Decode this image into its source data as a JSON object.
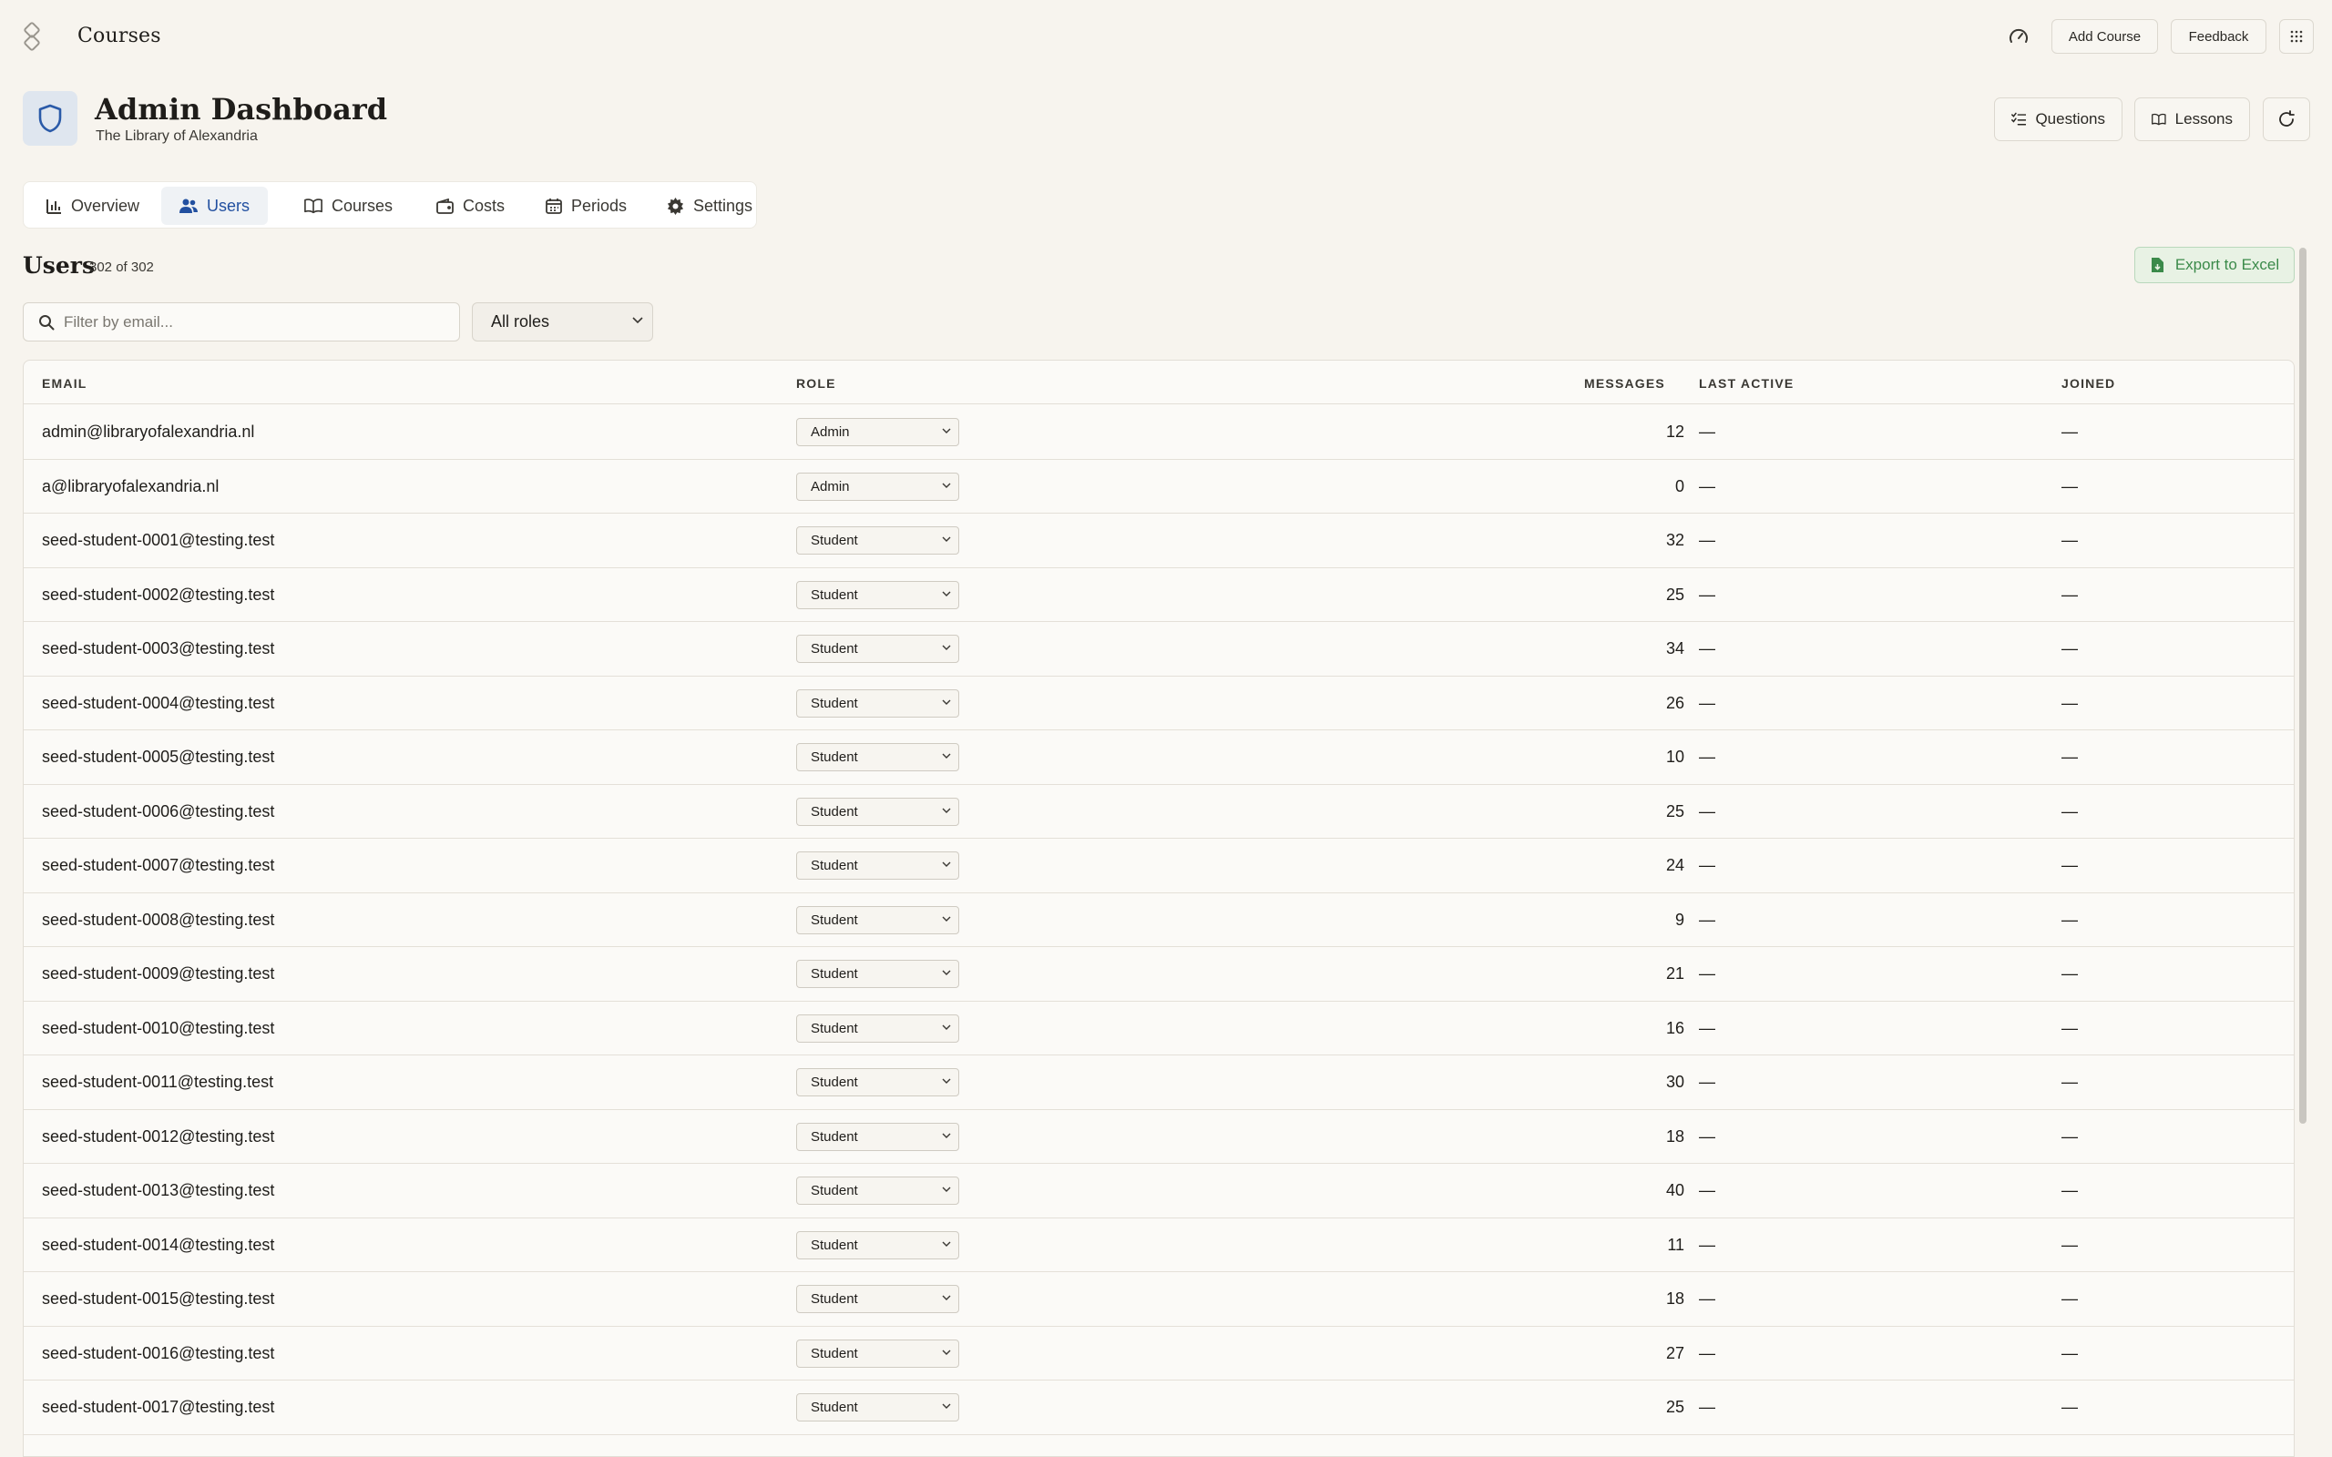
{
  "app": {
    "title": "Courses",
    "buttons": {
      "add_course": "Add Course",
      "feedback": "Feedback"
    }
  },
  "header": {
    "title": "Admin Dashboard",
    "subtitle": "The Library of Alexandria",
    "buttons": {
      "questions": "Questions",
      "lessons": "Lessons"
    }
  },
  "tabs": [
    {
      "label": "Overview",
      "icon": "bar-chart-icon",
      "active": false
    },
    {
      "label": "Users",
      "icon": "users-icon",
      "active": true
    },
    {
      "label": "Courses",
      "icon": "book-icon",
      "active": false
    },
    {
      "label": "Costs",
      "icon": "wallet-icon",
      "active": false
    },
    {
      "label": "Periods",
      "icon": "calendar-icon",
      "active": false
    },
    {
      "label": "Settings",
      "icon": "gear-icon",
      "active": false
    }
  ],
  "users": {
    "title": "Users",
    "count": "302 of 302",
    "export_label": "Export to Excel",
    "search_placeholder": "Filter by email...",
    "role_filter": "All roles"
  },
  "table": {
    "columns": {
      "email": "EMAIL",
      "role": "ROLE",
      "messages": "MESSAGES",
      "last_active": "LAST ACTIVE",
      "joined": "JOINED"
    },
    "rows": [
      {
        "email": "admin@libraryofalexandria.nl",
        "role": "Admin",
        "messages": "12",
        "last_active": "—",
        "joined": "—"
      },
      {
        "email": "a@libraryofalexandria.nl",
        "role": "Admin",
        "messages": "0",
        "last_active": "—",
        "joined": "—"
      },
      {
        "email": "seed-student-0001@testing.test",
        "role": "Student",
        "messages": "32",
        "last_active": "—",
        "joined": "—"
      },
      {
        "email": "seed-student-0002@testing.test",
        "role": "Student",
        "messages": "25",
        "last_active": "—",
        "joined": "—"
      },
      {
        "email": "seed-student-0003@testing.test",
        "role": "Student",
        "messages": "34",
        "last_active": "—",
        "joined": "—"
      },
      {
        "email": "seed-student-0004@testing.test",
        "role": "Student",
        "messages": "26",
        "last_active": "—",
        "joined": "—"
      },
      {
        "email": "seed-student-0005@testing.test",
        "role": "Student",
        "messages": "10",
        "last_active": "—",
        "joined": "—"
      },
      {
        "email": "seed-student-0006@testing.test",
        "role": "Student",
        "messages": "25",
        "last_active": "—",
        "joined": "—"
      },
      {
        "email": "seed-student-0007@testing.test",
        "role": "Student",
        "messages": "24",
        "last_active": "—",
        "joined": "—"
      },
      {
        "email": "seed-student-0008@testing.test",
        "role": "Student",
        "messages": "9",
        "last_active": "—",
        "joined": "—"
      },
      {
        "email": "seed-student-0009@testing.test",
        "role": "Student",
        "messages": "21",
        "last_active": "—",
        "joined": "—"
      },
      {
        "email": "seed-student-0010@testing.test",
        "role": "Student",
        "messages": "16",
        "last_active": "—",
        "joined": "—"
      },
      {
        "email": "seed-student-0011@testing.test",
        "role": "Student",
        "messages": "30",
        "last_active": "—",
        "joined": "—"
      },
      {
        "email": "seed-student-0012@testing.test",
        "role": "Student",
        "messages": "18",
        "last_active": "—",
        "joined": "—"
      },
      {
        "email": "seed-student-0013@testing.test",
        "role": "Student",
        "messages": "40",
        "last_active": "—",
        "joined": "—"
      },
      {
        "email": "seed-student-0014@testing.test",
        "role": "Student",
        "messages": "11",
        "last_active": "—",
        "joined": "—"
      },
      {
        "email": "seed-student-0015@testing.test",
        "role": "Student",
        "messages": "18",
        "last_active": "—",
        "joined": "—"
      },
      {
        "email": "seed-student-0016@testing.test",
        "role": "Student",
        "messages": "27",
        "last_active": "—",
        "joined": "—"
      },
      {
        "email": "seed-student-0017@testing.test",
        "role": "Student",
        "messages": "25",
        "last_active": "—",
        "joined": "—"
      }
    ]
  },
  "colors": {
    "background": "#f7f4ee",
    "accent": "#2250a0",
    "export_green": "#3b8a4a"
  }
}
